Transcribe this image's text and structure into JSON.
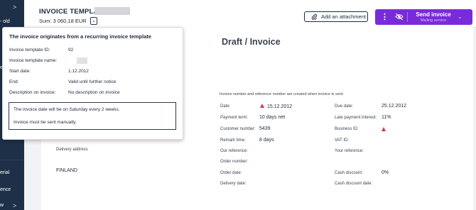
{
  "sidebar": {
    "items": [
      {
        "label": "- old"
      },
      {
        "label": "e"
      },
      {
        "label": "erial"
      },
      {
        "label": "ence"
      },
      {
        "label": "w"
      }
    ]
  },
  "header": {
    "title": "INVOICE TEMPLATE:",
    "sum": "Sum: 3 060,18 EUR",
    "attach_label": "Add an attachment",
    "send_label": "Send invoice",
    "send_sub": "Mailing service"
  },
  "popup": {
    "title": "The invoice originates from a recurring invoice template",
    "rows": [
      {
        "label": "Invoice template ID:",
        "value": "92"
      },
      {
        "label": "Invoice template name:",
        "value": ""
      },
      {
        "label": "Start date:",
        "value": "1.12.2012"
      },
      {
        "label": "End:",
        "value": "Valid until further notice"
      },
      {
        "label": "Description on invoice:",
        "value": "No description on invoice"
      }
    ],
    "box_line1": "The invoice date will be on Saturday every 2 weeks.",
    "box_line2": "Invoice must be sent manually."
  },
  "document": {
    "title": "Draft / Invoice",
    "note": "Invoice number and reference number are created when invoice is sent.",
    "delivery_address_label": "Delivery address",
    "country": "FINLAND",
    "left_fields": [
      {
        "label": "Date:",
        "value": "15.12.2012",
        "warn": true
      },
      {
        "label": "Payment term:",
        "value": "10 days net"
      },
      {
        "label": "Customer number:",
        "value": "5439"
      },
      {
        "label": "Remark time:",
        "value": "8 days"
      },
      {
        "label": "Our reference:",
        "value": ""
      },
      {
        "label": "Order number:",
        "value": ""
      },
      {
        "label": "Order date:",
        "value": ""
      },
      {
        "label": "Delivery date:",
        "value": ""
      }
    ],
    "right_fields": [
      {
        "label": "Due date:",
        "value": "25.12.2012"
      },
      {
        "label": "Late payment interest:",
        "value": "11%"
      },
      {
        "label": "Business ID:",
        "value": "",
        "warn": true
      },
      {
        "label": "VAT ID:",
        "value": ""
      },
      {
        "label": "Your reference:",
        "value": ""
      },
      {
        "label": "Cash discount:",
        "value": "0%"
      },
      {
        "label": "Cash discount date:",
        "value": ""
      }
    ]
  },
  "colors": {
    "sidebar": "#1e3048",
    "accent": "#7a2bd9",
    "warning": "#d9363e"
  }
}
